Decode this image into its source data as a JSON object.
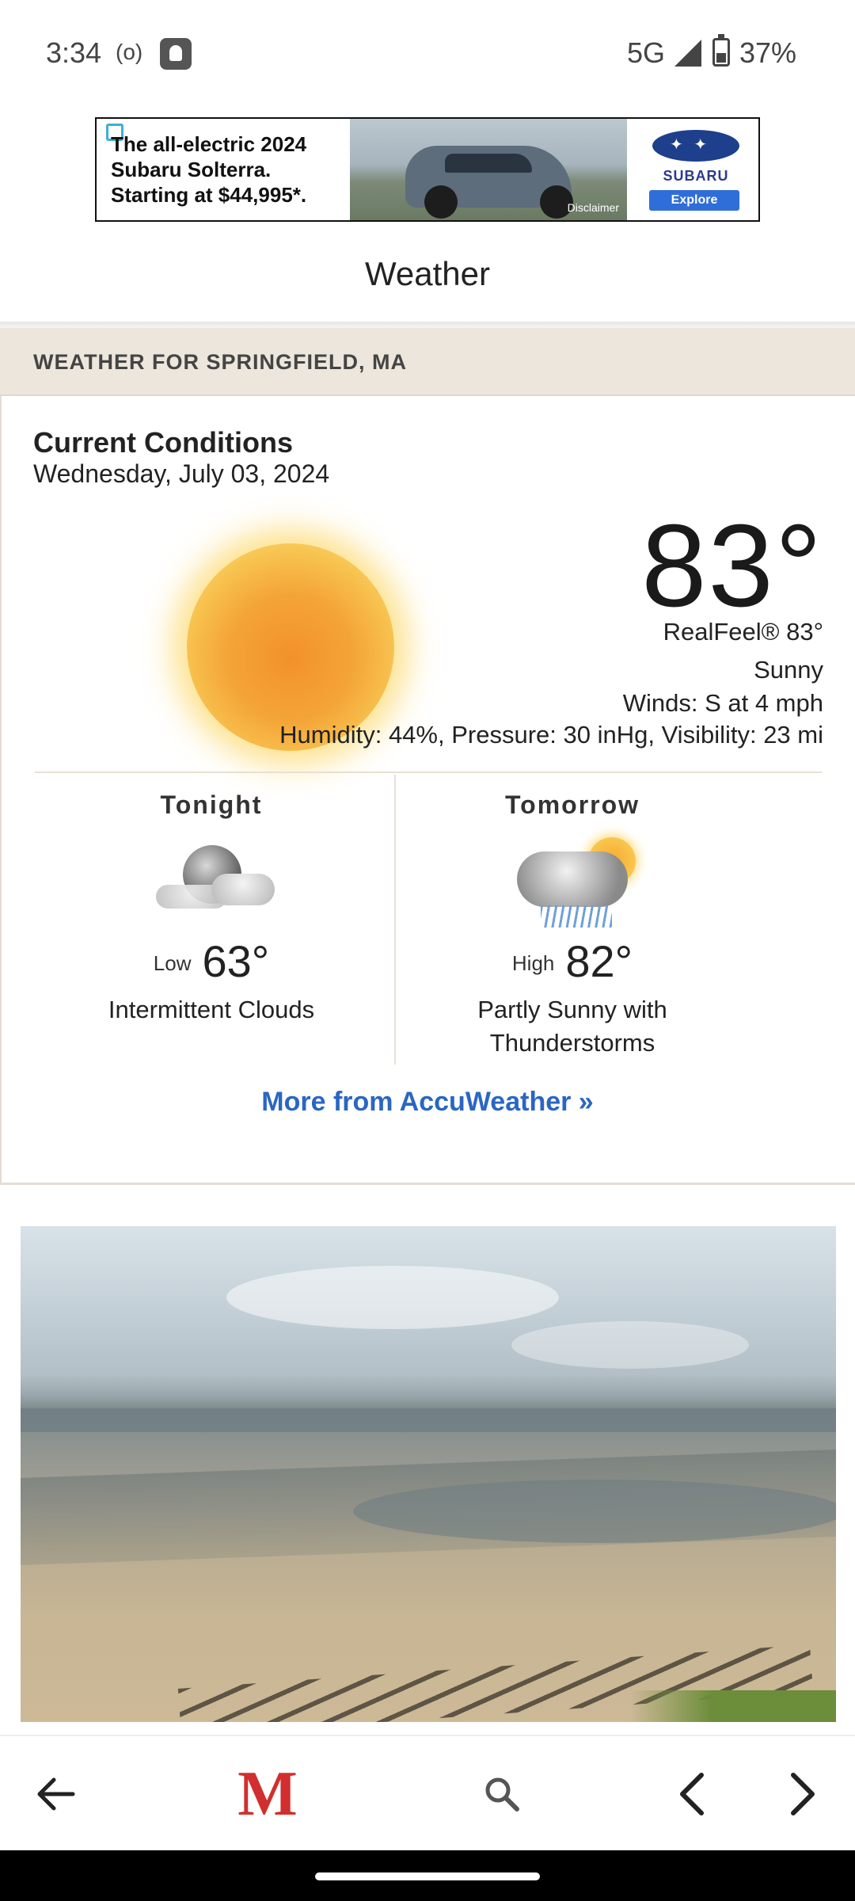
{
  "status_bar": {
    "time": "3:34",
    "radio": "(o)",
    "network": "5G",
    "battery": "37%"
  },
  "ad": {
    "line1": "The all-electric 2024",
    "line2": "Subaru Solterra.",
    "line3": "Starting at $44,995*.",
    "disclaimer": "Disclaimer",
    "brand": "SUBARU",
    "cta": "Explore"
  },
  "page": {
    "title": "Weather"
  },
  "weather": {
    "header": "WEATHER FOR SPRINGFIELD, MA",
    "current": {
      "title": "Current Conditions",
      "date": "Wednesday, July 03, 2024",
      "temperature": "83°",
      "realfeel": "RealFeel® 83°",
      "condition": "Sunny",
      "winds": "Winds: S at 4 mph",
      "details": "Humidity: 44%, Pressure: 30 inHg, Visibility: 23 mi",
      "icon": "sun-icon"
    },
    "tonight": {
      "label": "Tonight",
      "prefix": "Low",
      "temperature": "63°",
      "description": "Intermittent Clouds",
      "icon": "moon-cloud-icon"
    },
    "tomorrow": {
      "label": "Tomorrow",
      "prefix": "High",
      "temperature": "82°",
      "description": "Partly Sunny with Thunderstorms",
      "icon": "sun-cloud-storm-icon"
    },
    "more_link": "More from AccuWeather »"
  },
  "photo": {
    "subject": "beach-photo"
  },
  "bottom_nav": {
    "home_logo": "M",
    "icons": [
      "back-arrow-icon",
      "masslive-logo",
      "search-icon",
      "chevron-left-icon",
      "chevron-right-icon"
    ]
  },
  "colors": {
    "link": "#2a66c4",
    "header_bg": "#ece6dc",
    "logo_red": "#d12f2f"
  }
}
